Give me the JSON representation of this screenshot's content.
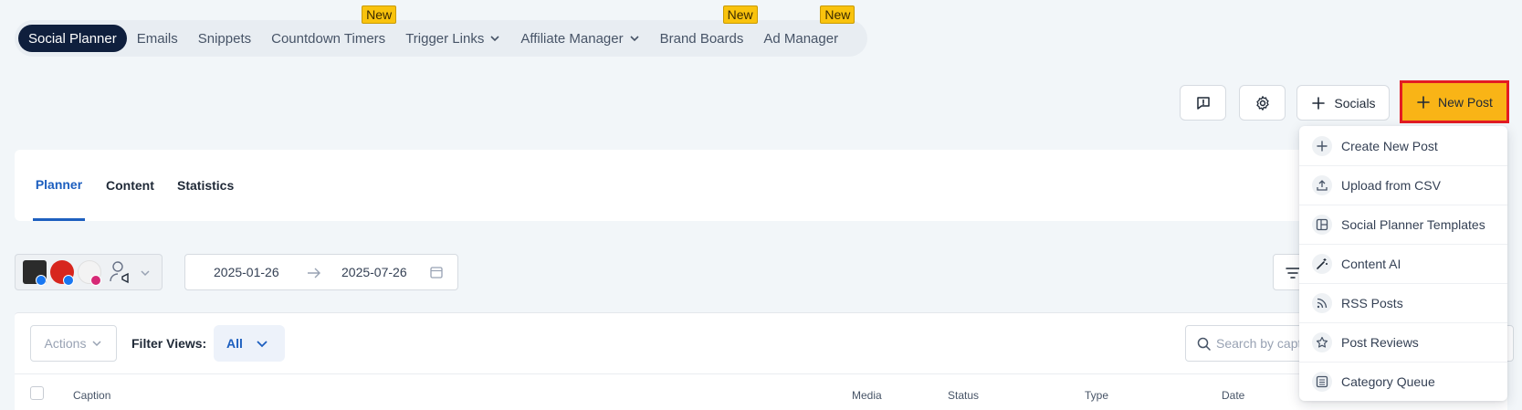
{
  "topnav": {
    "items": [
      {
        "label": "Social Planner",
        "active": true
      },
      {
        "label": "Emails"
      },
      {
        "label": "Snippets"
      },
      {
        "label": "Countdown Timers",
        "badge": "New"
      },
      {
        "label": "Trigger Links",
        "dropdown": true
      },
      {
        "label": "Affiliate Manager",
        "dropdown": true
      },
      {
        "label": "Brand Boards",
        "badge": "New"
      },
      {
        "label": "Ad Manager",
        "badge": "New"
      }
    ]
  },
  "toolbar": {
    "feedback_icon": "message-alert-icon",
    "settings_icon": "gear-icon",
    "socials_label": "Socials",
    "new_post_label": "New Post"
  },
  "tabs": [
    {
      "label": "Planner",
      "active": true
    },
    {
      "label": "Content"
    },
    {
      "label": "Statistics"
    }
  ],
  "date_range": {
    "start": "2025-01-26",
    "end": "2025-07-26"
  },
  "table": {
    "actions_label": "Actions",
    "filter_views_label": "Filter Views:",
    "filter_views_value": "All",
    "search_placeholder": "Search by caption",
    "columns": [
      "Caption",
      "Media",
      "Status",
      "Type",
      "Date"
    ]
  },
  "new_post_menu": {
    "items": [
      {
        "label": "Create New Post",
        "icon": "plus-icon"
      },
      {
        "label": "Upload from CSV",
        "icon": "upload-icon"
      },
      {
        "label": "Social Planner Templates",
        "icon": "template-icon"
      },
      {
        "label": "Content AI",
        "icon": "magic-wand-icon"
      },
      {
        "label": "RSS Posts",
        "icon": "rss-icon"
      },
      {
        "label": "Post Reviews",
        "icon": "star-icon"
      },
      {
        "label": "Category Queue",
        "icon": "list-icon"
      }
    ]
  },
  "colors": {
    "accent": "#f9b416",
    "highlight_border": "#e31b23",
    "active_nav": "#0f1f3d",
    "link_blue": "#1d5fbf",
    "badge": "#f9c30d"
  }
}
